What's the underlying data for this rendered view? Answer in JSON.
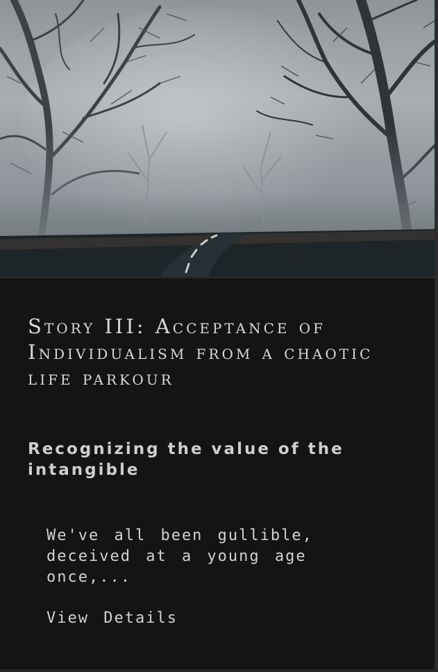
{
  "story": {
    "title": "Story III: Acceptance of Individualism from a chaotic life parkour",
    "subtitle": "Recognizing the value of the intangible",
    "excerpt": "We've all been gullible, deceived at a young age once,...",
    "details_label": "View Details"
  },
  "colors": {
    "background": "#141414",
    "text": "#d2d2d2"
  }
}
